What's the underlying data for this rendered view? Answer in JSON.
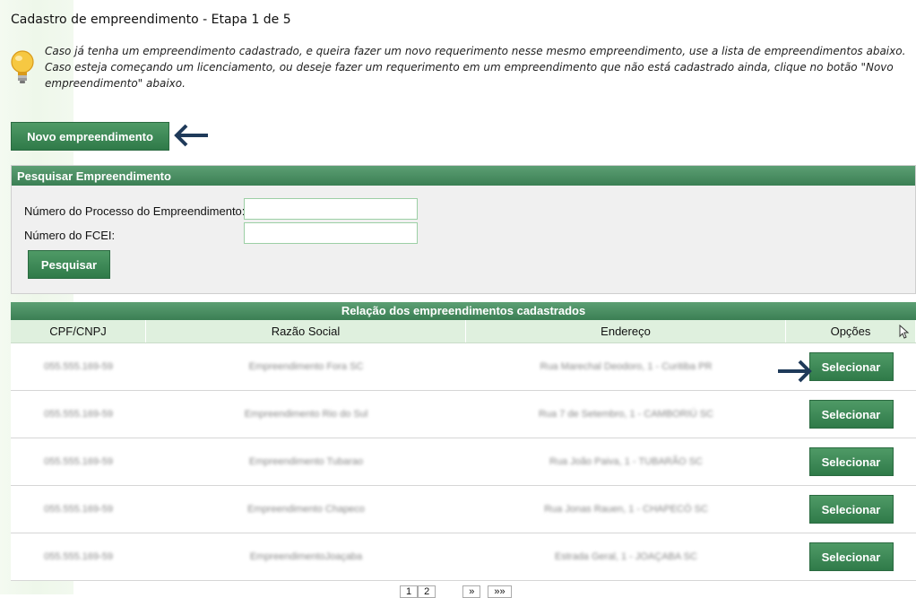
{
  "page": {
    "title": "Cadastro de empreendimento - Etapa 1 de 5",
    "info": "Caso já tenha um empreendimento cadastrado, e queira fazer um novo requerimento nesse mesmo empreendimento, use a lista de empreendimentos abaixo. Caso esteja começando um licenciamento, ou deseje fazer um requerimento em um empreendimento que não está cadastrado ainda, clique no botão \"Novo empreendimento\" abaixo.",
    "info_icon": "lightbulb-icon"
  },
  "novo_button": "Novo empreendimento",
  "search": {
    "title": "Pesquisar Empreendimento",
    "processo_label": "Número do Processo do Empreendimento:",
    "processo_value": "",
    "fcei_label": "Número do FCEI:",
    "fcei_value": "",
    "button": "Pesquisar"
  },
  "results": {
    "title": "Relação dos empreendimentos cadastrados",
    "columns": [
      "CPF/CNPJ",
      "Razão Social",
      "Endereço",
      "Opções"
    ],
    "rows": [
      {
        "cpf": "055.555.169-59",
        "razao": "Empreendimento Fora SC",
        "endereco": "Rua Marechal Deodoro, 1 - Curitiba PR",
        "action": "Selecionar"
      },
      {
        "cpf": "055.555.169-59",
        "razao": "Empreendimento Rio do Sul",
        "endereco": "Rua 7 de Setembro, 1 - CAMBORIÚ SC",
        "action": "Selecionar"
      },
      {
        "cpf": "055.555.169-59",
        "razao": "Empreendimento Tubarao",
        "endereco": "Rua João Paiva, 1 - TUBARÃO SC",
        "action": "Selecionar"
      },
      {
        "cpf": "055.555.169-59",
        "razao": "Empreendimento Chapeco",
        "endereco": "Rua Jonas Rauen, 1 - CHAPECÓ SC",
        "action": "Selecionar"
      },
      {
        "cpf": "055.555.169-59",
        "razao": "EmpreendimentoJoaçaba",
        "endereco": "Estrada Geral, 1 - JOAÇABA SC",
        "action": "Selecionar"
      }
    ]
  },
  "pagination": {
    "pages": [
      "1",
      "2"
    ],
    "next": "»",
    "last": "»»"
  },
  "colors": {
    "accent_green": "#3b7f54",
    "header_light": "#dff0de",
    "arrow_navy": "#1f3a5a"
  }
}
